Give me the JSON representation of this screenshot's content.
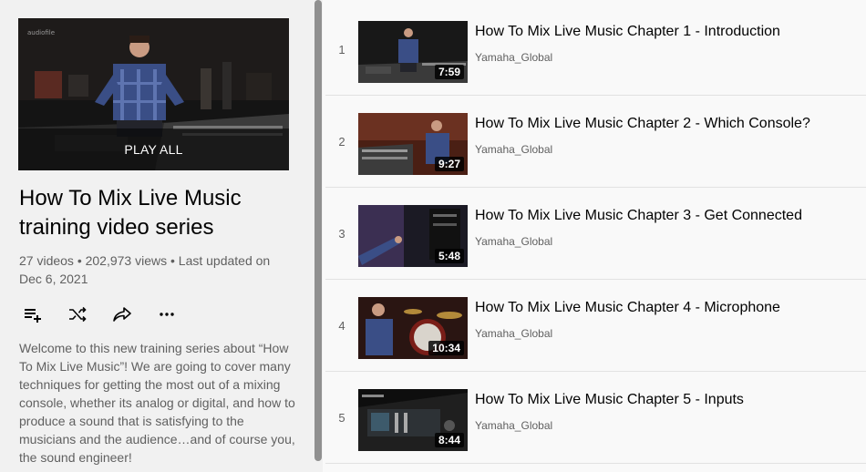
{
  "playlist": {
    "play_all": "PLAY ALL",
    "title": "How To Mix Live Music training video series",
    "stats": "27 videos • 202,973 views • Last updated on Dec 6, 2021",
    "description": "Welcome to this new training series about “How To Mix Live Music”! We are going to cover many techniques for getting the most out of a mixing console, whether its analog or digital, and how to produce a sound that is satisfying to the musicians and the audience…and of course you, the sound engineer!",
    "actions": [
      "add-to-queue-icon",
      "shuffle-icon",
      "share-icon",
      "more-icon"
    ]
  },
  "videos": [
    {
      "index": "1",
      "title": "How To Mix Live Music Chapter 1 - Introduction",
      "channel": "Yamaha_Global",
      "duration": "7:59"
    },
    {
      "index": "2",
      "title": "How To Mix Live Music Chapter 2 - Which Console?",
      "channel": "Yamaha_Global",
      "duration": "9:27"
    },
    {
      "index": "3",
      "title": "How To Mix Live Music Chapter 3 - Get Connected",
      "channel": "Yamaha_Global",
      "duration": "5:48"
    },
    {
      "index": "4",
      "title": "How To Mix Live Music Chapter 4 - Microphone",
      "channel": "Yamaha_Global",
      "duration": "10:34"
    },
    {
      "index": "5",
      "title": "How To Mix Live Music Chapter 5 - Inputs",
      "channel": "Yamaha_Global",
      "duration": "8:44"
    }
  ],
  "colors": {
    "text": "#030303",
    "secondary": "#606060",
    "sidebar": "#f1f1f1",
    "background": "#f9f9f9"
  }
}
